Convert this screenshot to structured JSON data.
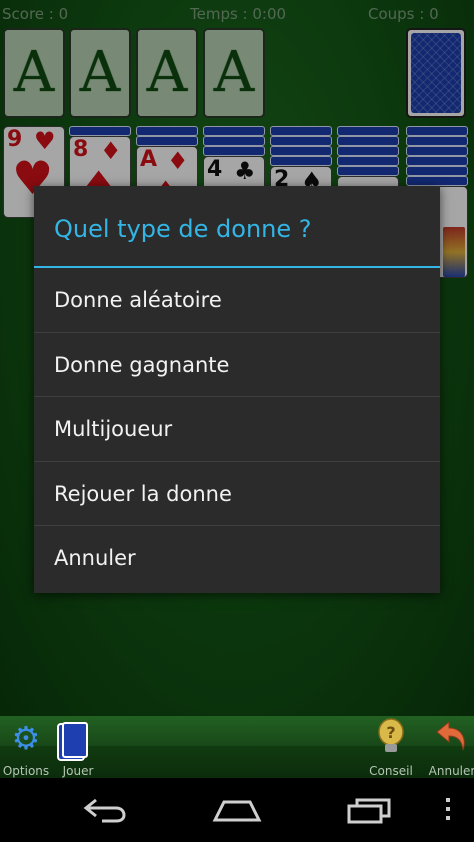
{
  "status_bar": {
    "score": "Score : 0",
    "time": "Temps : 0:00",
    "moves": "Coups : 0"
  },
  "foundations": [
    "A",
    "A",
    "A",
    "A"
  ],
  "tableau": [
    {
      "rank": "9",
      "suit": "♥",
      "color": "red",
      "hidden": 0
    },
    {
      "rank": "8",
      "suit": "♦",
      "color": "red",
      "hidden": 1
    },
    {
      "rank": "A",
      "suit": "♦",
      "color": "red",
      "hidden": 2
    },
    {
      "rank": "4",
      "suit": "♣",
      "color": "black",
      "hidden": 3
    },
    {
      "rank": "2",
      "suit": "♠",
      "color": "black",
      "hidden": 4
    },
    {
      "rank": "",
      "suit": "♦",
      "color": "red",
      "hidden": 5
    },
    {
      "rank": "",
      "suit": "",
      "color": "black",
      "hidden": 6
    }
  ],
  "dialog": {
    "title": "Quel type de donne ?",
    "items": [
      "Donne aléatoire",
      "Donne gagnante",
      "Multijoueur",
      "Rejouer la donne",
      "Annuler"
    ]
  },
  "toolbar": {
    "options_label": "Options",
    "play_label": "Jouer",
    "hint_label": "Conseil",
    "undo_label": "Annuler"
  },
  "icons": {
    "options": "gear-icon",
    "play": "deck-icon",
    "hint": "lightbulb-icon",
    "undo": "undo-arrow-icon"
  },
  "colors": {
    "accent": "#33b5e5",
    "felt": "#145a17",
    "dialog_bg": "#2b2b2b"
  }
}
